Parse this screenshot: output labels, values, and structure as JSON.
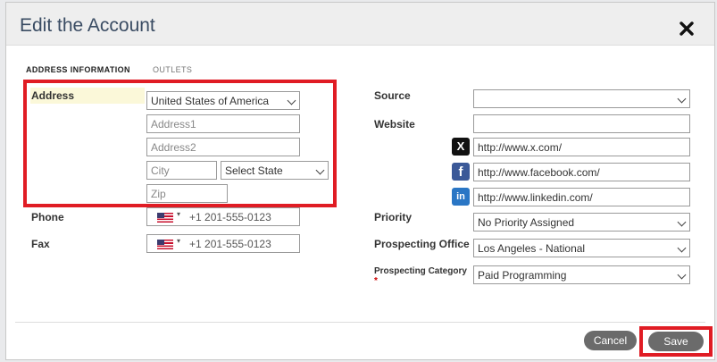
{
  "dialog": {
    "title": "Edit the Account",
    "close_icon": "close-icon"
  },
  "tabs": [
    {
      "label": "ADDRESS INFORMATION",
      "active": true
    },
    {
      "label": "OUTLETS",
      "active": false
    }
  ],
  "address": {
    "label": "Address",
    "country": "United States of America",
    "address1_placeholder": "Address1",
    "address2_placeholder": "Address2",
    "city_placeholder": "City",
    "state": "Select State",
    "zip_placeholder": "Zip"
  },
  "phone": {
    "label": "Phone",
    "country_flag": "us-flag-icon",
    "placeholder": "+1 201-555-0123"
  },
  "fax": {
    "label": "Fax",
    "country_flag": "us-flag-icon",
    "placeholder": "+1 201-555-0123"
  },
  "source": {
    "label": "Source",
    "value": ""
  },
  "website": {
    "label": "Website",
    "value": ""
  },
  "social": {
    "x": {
      "icon": "x-icon",
      "glyph": "X",
      "value": "http://www.x.com/"
    },
    "facebook": {
      "icon": "facebook-icon",
      "glyph": "f",
      "value": "http://www.facebook.com/"
    },
    "linkedin": {
      "icon": "linkedin-icon",
      "glyph": "in",
      "value": "http://www.linkedin.com/"
    }
  },
  "priority": {
    "label": "Priority",
    "value": "No Priority Assigned"
  },
  "prospecting_office": {
    "label": "Prospecting Office",
    "value": "Los Angeles - National"
  },
  "prospecting_category": {
    "label": "Prospecting Category",
    "required_mark": "*",
    "value": "Paid Programming"
  },
  "buttons": {
    "cancel": "Cancel",
    "save": "Save"
  },
  "colors": {
    "highlight": "#e01c24",
    "title": "#3a4c63",
    "button": "#6b6b6b"
  }
}
